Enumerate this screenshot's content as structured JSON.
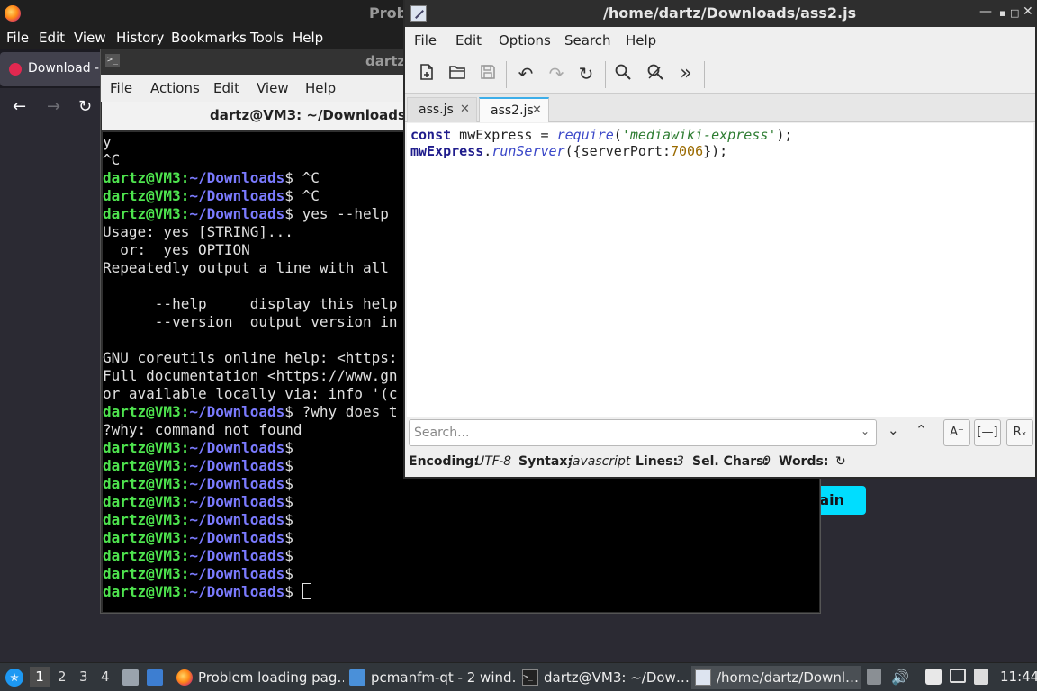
{
  "firefox": {
    "title": "Prob",
    "menu": [
      "File",
      "Edit",
      "View",
      "History",
      "Bookmarks",
      "Tools",
      "Help"
    ],
    "tab_label": "Download -",
    "button_label": "ain"
  },
  "terminal": {
    "titlebar": "dartz",
    "menu": [
      "File",
      "Actions",
      "Edit",
      "View",
      "Help"
    ],
    "tab_title": "dartz@VM3: ~/Downloads",
    "prompt_user": "dartz@VM3:",
    "prompt_dir": "~/Downloads",
    "lines": [
      {
        "text": "y"
      },
      {
        "text": "^C"
      },
      {
        "prompt": true,
        "cmd": " ^C"
      },
      {
        "prompt": true,
        "cmd": " ^C"
      },
      {
        "prompt": true,
        "cmd": " yes --help"
      },
      {
        "text": "Usage: yes [STRING]..."
      },
      {
        "text": "  or:  yes OPTION"
      },
      {
        "text": "Repeatedly output a line with all"
      },
      {
        "text": ""
      },
      {
        "text": "      --help     display this help"
      },
      {
        "text": "      --version  output version in"
      },
      {
        "text": ""
      },
      {
        "text": "GNU coreutils online help: <https:"
      },
      {
        "text": "Full documentation <https://www.gn"
      },
      {
        "text": "or available locally via: info '(c"
      },
      {
        "prompt": true,
        "cmd": " ?why does t"
      },
      {
        "text": "?why: command not found"
      },
      {
        "prompt": true,
        "cmd": ""
      },
      {
        "prompt": true,
        "cmd": ""
      },
      {
        "prompt": true,
        "cmd": ""
      },
      {
        "prompt": true,
        "cmd": ""
      },
      {
        "prompt": true,
        "cmd": ""
      },
      {
        "prompt": true,
        "cmd": ""
      },
      {
        "prompt": true,
        "cmd": ""
      },
      {
        "prompt": true,
        "cmd": ""
      },
      {
        "prompt": true,
        "cmd": " ",
        "cursor": true
      }
    ]
  },
  "editor": {
    "title": "/home/dartz/Downloads/ass2.js",
    "menu": [
      "File",
      "Edit",
      "Options",
      "Search",
      "Help"
    ],
    "tabs": [
      "ass.js",
      "ass2.js"
    ],
    "code": {
      "l1_kw": "const",
      "l1_var": " mwExpress = ",
      "l1_fn": "require",
      "l1_p1": "(",
      "l1_str": "'mediawiki-express'",
      "l1_p2": ");",
      "l2_obj": "mwExpress",
      "l2_dot": ".",
      "l2_fn": "runServer",
      "l2_p1": "({serverPort:",
      "l2_num": "7006",
      "l2_p2": "});"
    },
    "search_placeholder": "Search...",
    "status": {
      "encoding_label": "Encoding:",
      "encoding_value": "UTF-8",
      "syntax_label": "Syntax:",
      "syntax_value": "javascript",
      "lines_label": "Lines:",
      "lines_value": "3",
      "selchars_label": "Sel. Chars:",
      "selchars_value": "0",
      "words_label": "Words:"
    }
  },
  "taskbar": {
    "desktops": [
      "1",
      "2",
      "3",
      "4"
    ],
    "tasks": [
      {
        "label": "Problem loading pag…",
        "icon": "firefox-icon"
      },
      {
        "label": "pcmanfm-qt - 2 wind…",
        "icon": "folder-icon"
      },
      {
        "label": "dartz@VM3: ~/Dow…",
        "icon": "terminal-icon"
      },
      {
        "label": "/home/dartz/Downl…",
        "icon": "text-editor-icon"
      }
    ],
    "clock": "11:44"
  }
}
